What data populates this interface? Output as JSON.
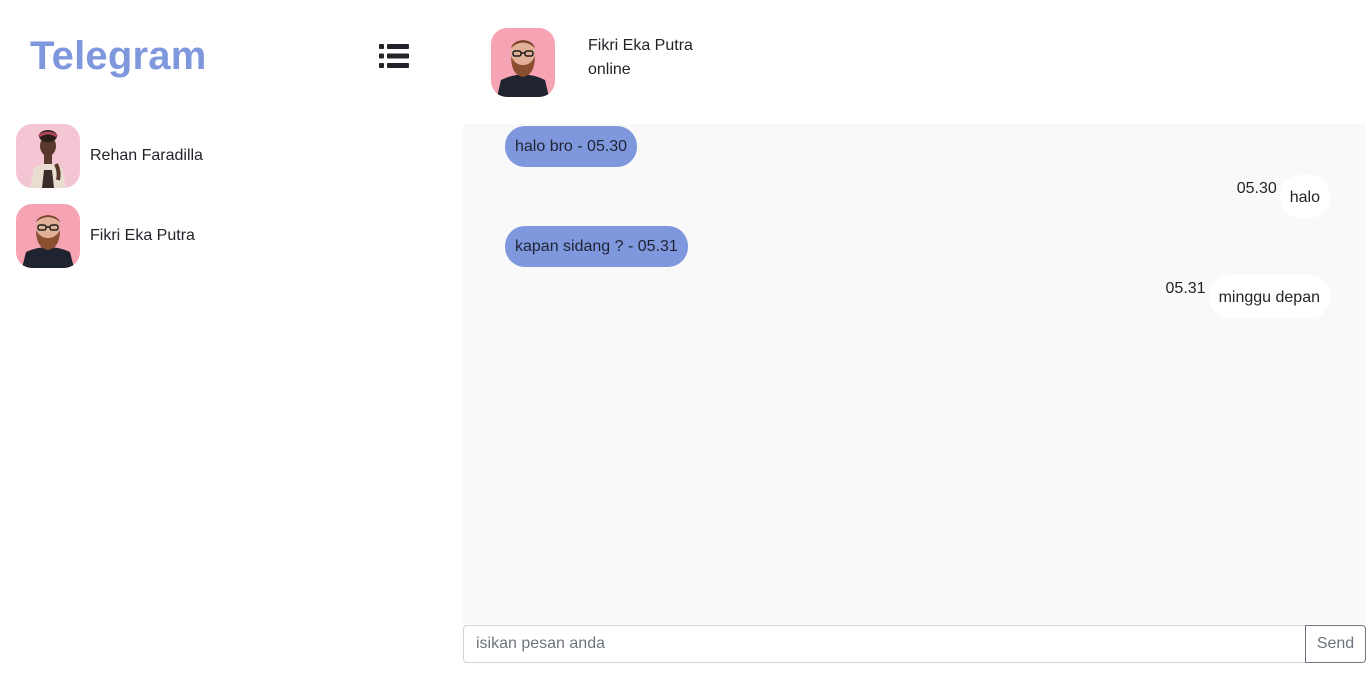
{
  "app": {
    "brand": "Telegram",
    "accent_color": "#7e97dd"
  },
  "sidebar": {
    "menu_icon": "list-icon",
    "contacts": [
      {
        "name": "Rehan Faradilla",
        "avatar": "woman-avatar"
      },
      {
        "name": "Fikri Eka Putra",
        "avatar": "bearded-man-avatar"
      }
    ]
  },
  "chat": {
    "peer": {
      "name": "Fikri Eka Putra",
      "status": "online",
      "avatar": "bearded-man-avatar"
    },
    "messages": [
      {
        "direction": "in",
        "text": "halo bro - 05.30"
      },
      {
        "direction": "out",
        "time": "05.30",
        "text": "halo"
      },
      {
        "direction": "in",
        "text": "kapan sidang ? - 05.31"
      },
      {
        "direction": "out",
        "time": "05.31",
        "text": "minggu depan"
      }
    ],
    "composer": {
      "placeholder": "isikan pesan anda",
      "send_label": "Send"
    }
  }
}
